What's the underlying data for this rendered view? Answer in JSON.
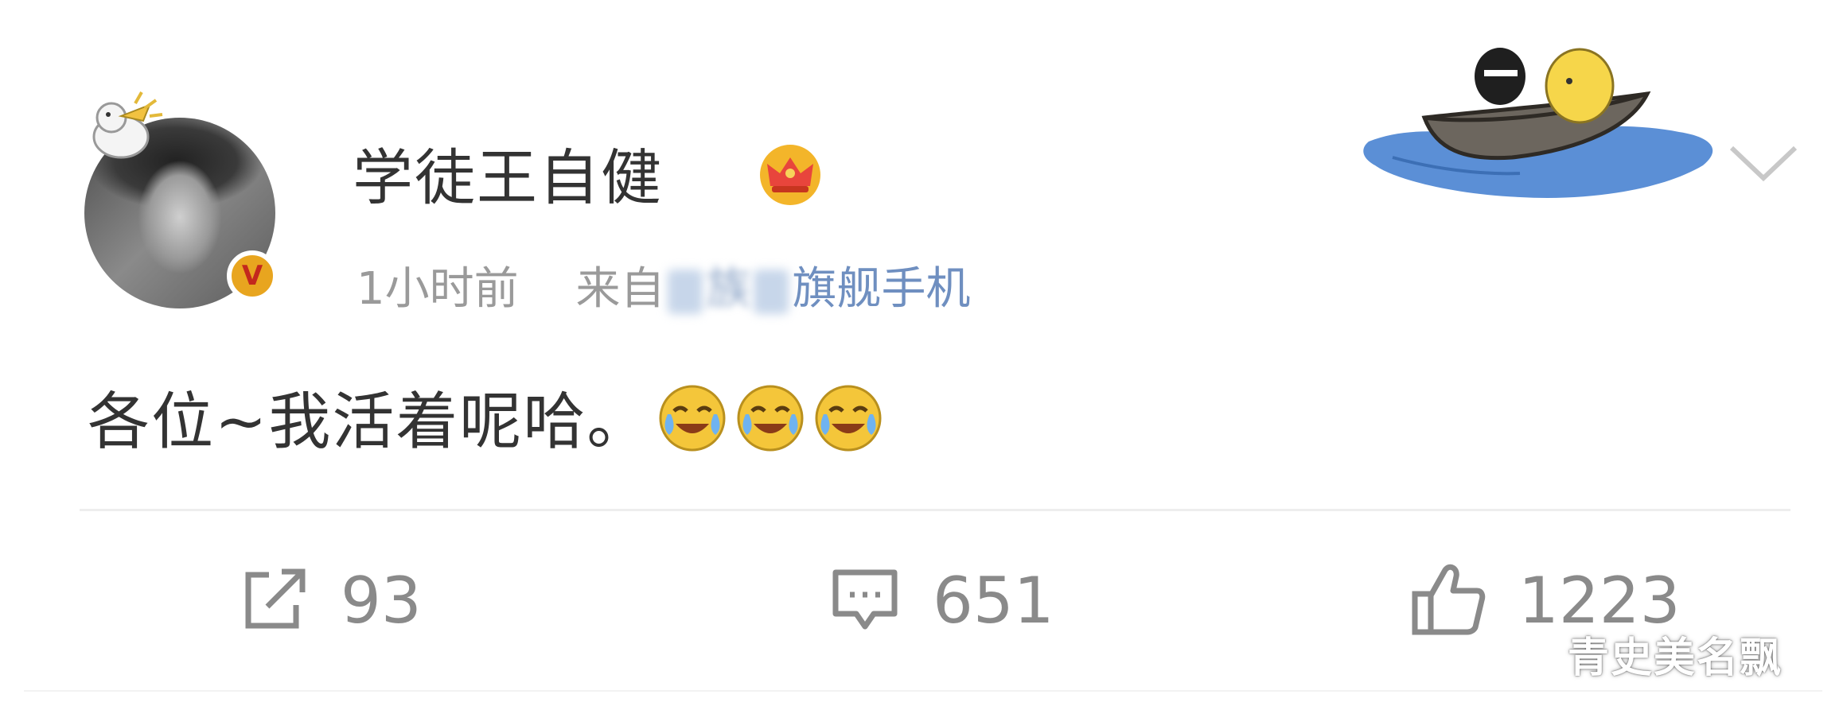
{
  "post": {
    "username": "学徒王自健",
    "time": "1小时前",
    "source_prefix": "来自",
    "source_visible": "族",
    "source_suffix": "旗舰手机",
    "text": "各位~我活着呢哈。"
  },
  "actions": {
    "repost_count": "93",
    "comment_count": "651",
    "like_count": "1223"
  },
  "watermark": "青史美名飘",
  "icons": {
    "vip": "v-verified-badge",
    "crown": "crown-icon",
    "emoji": "laugh-cry-emoji",
    "menu": "chevron-down-icon"
  },
  "colors": {
    "text": "#333333",
    "meta": "#9a9a9a",
    "action": "#8a8a8a",
    "vip_badge": "#e8a51f"
  }
}
